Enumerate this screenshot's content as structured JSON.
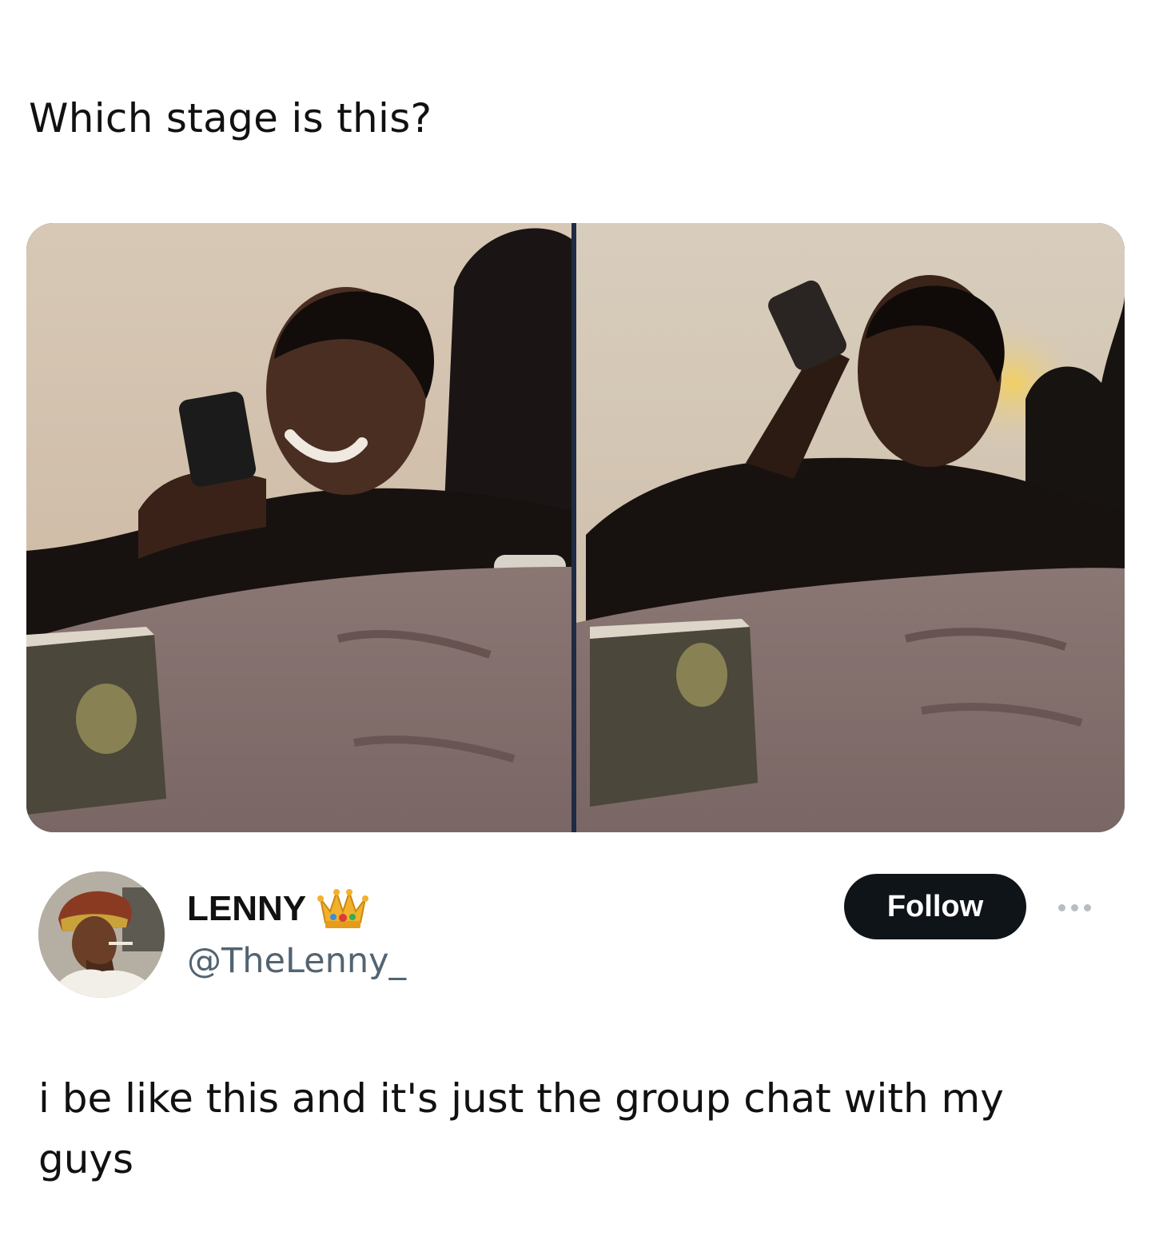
{
  "caption": {
    "text": "Which stage is this?"
  },
  "media": {
    "panels": 2,
    "description_icon": "photo-collage"
  },
  "author": {
    "display_name": "LENNY",
    "badge_icon": "crown-emoji",
    "handle": "@TheLenny_",
    "avatar_icon": "user-avatar"
  },
  "actions": {
    "follow_label": "Follow",
    "more_icon": "more-options-icon"
  },
  "post": {
    "text": "i be like this and it's just the group chat with my guys"
  },
  "colors": {
    "follow_button_bg": "#0f1419",
    "follow_button_text": "#ffffff",
    "handle_text": "#536471",
    "body_text": "#111111"
  }
}
